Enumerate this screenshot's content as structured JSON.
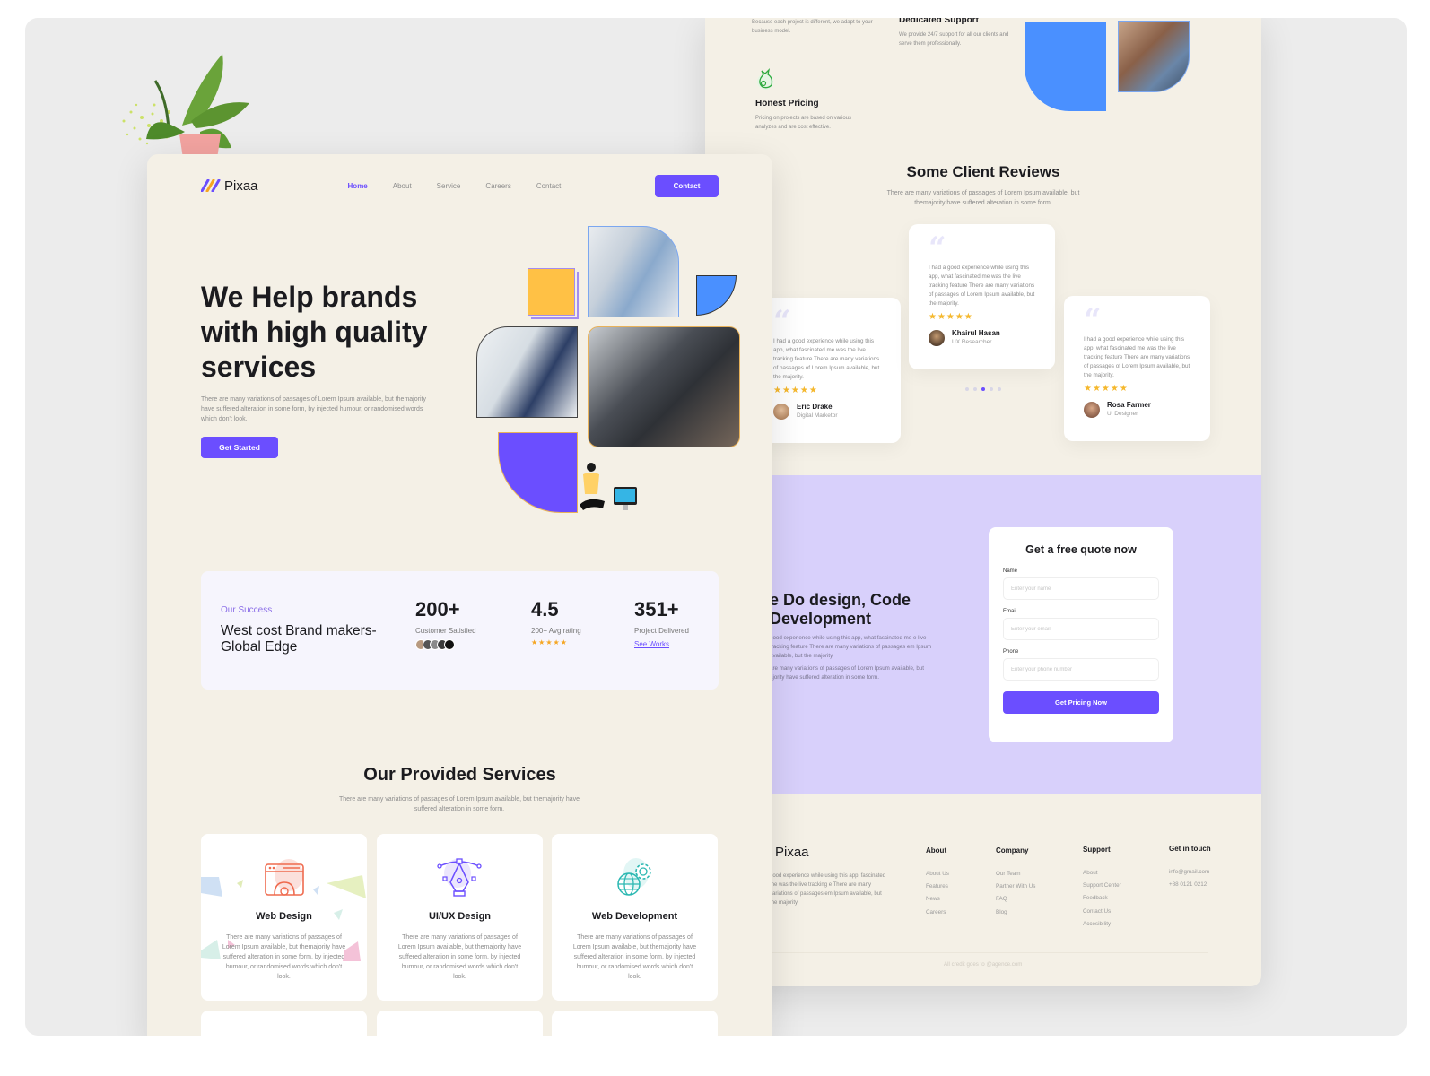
{
  "back_page": {
    "features": [
      {
        "title": "",
        "text": "Because each project is different, we adapt to your business model."
      },
      {
        "title": "Dedicated Support",
        "text": "We provide 24/7 support for all our clients and serve them professionally."
      },
      {
        "title": "Honest Pricing",
        "text": "Pricing on projects are based on various analyzes and are cost effective."
      }
    ],
    "reviews": {
      "title": "Some Client Reviews",
      "subtitle": "There are many variations of passages of Lorem Ipsum available, but themajority have suffered alteration in some form.",
      "items": [
        {
          "text": "I had a good experience while using this app, what fascinated me was the live tracking feature There are many variations of passages of Lorem Ipsum available, but the majority.",
          "stars": "★★★★★",
          "name": "Eric Drake",
          "role": "Digital Marketor"
        },
        {
          "text": "I had a good experience while using this app, what fascinated me was the live tracking feature There are many variations of passages of Lorem Ipsum available, but the majority.",
          "stars": "★★★★★",
          "name": "Khairul Hasan",
          "role": "UX Researcher"
        },
        {
          "text": "I had a good experience while using this app, what fascinated me was the live tracking feature There are many variations of passages of Lorem Ipsum available, but the majority.",
          "stars": "★★★★★",
          "name": "Rosa Farmer",
          "role": "UI Designer"
        }
      ],
      "active_dot": 2,
      "dot_count": 5
    },
    "quote_section": {
      "title": "e Do design, Code Development",
      "text1": "good experience while using this app, what fascinated me e live tracking feature There are many variations of passages em Ipsum available, but the majority.",
      "text2": "are many variations of passages of Lorem Ipsum available, but ajority have suffered alteration in some form.",
      "form": {
        "title": "Get a free quote now",
        "name_label": "Name",
        "name_placeholder": "Enter your name",
        "email_label": "Email",
        "email_placeholder": "Enter your email",
        "phone_label": "Phone",
        "phone_placeholder": "Enter your phone number",
        "submit": "Get Pricing Now"
      }
    },
    "footer": {
      "brand": "Pixaa",
      "text": "good experience while using this app, fascinated me was the live tracking e There are many variations of passages em Ipsum available, but the majority.",
      "columns": [
        {
          "title": "About",
          "links": [
            "About Us",
            "Features",
            "News",
            "Careers"
          ]
        },
        {
          "title": "Company",
          "links": [
            "Our Team",
            "Partner With Us",
            "FAQ",
            "Blog"
          ]
        },
        {
          "title": "Support",
          "links": [
            "About",
            "Support Center",
            "Feedback",
            "Contact Us",
            "Accesibility"
          ]
        },
        {
          "title": "Get in touch",
          "links": [
            "info@gmail.com",
            "+88 0121 0212"
          ]
        }
      ],
      "credit": "All credit goes to @agence.com"
    }
  },
  "front_page": {
    "brand": "Pixaa",
    "nav": [
      "Home",
      "About",
      "Service",
      "Careers",
      "Contact"
    ],
    "nav_active": "Home",
    "nav_button": "Contact",
    "hero": {
      "title": "We Help brands with high quality services",
      "text": "There are many variations of passages of Lorem Ipsum available, but themajority  have suffered alteration in some form, by injected humour, or randomised words which don't look.",
      "cta": "Get Started"
    },
    "success": {
      "label": "Our Success",
      "headline": "West cost Brand makers-Global Edge",
      "stats": [
        {
          "value": "200+",
          "desc": "Customer Satisfied"
        },
        {
          "value": "4.5",
          "desc": "200+ Avg rating",
          "stars": "★★★★★"
        },
        {
          "value": "351+",
          "desc": "Project Delivered",
          "link": "See Works"
        }
      ]
    },
    "services": {
      "title": "Our Provided Services",
      "subtitle": "There are many variations of passages of Lorem Ipsum available, but themajority have suffered alteration in some form.",
      "items": [
        {
          "title": "Web Design",
          "icon": "browser-gear-icon",
          "text": "There are many variations of passages of Lorem Ipsum available, but themajority have suffered alteration in some form, by injected humour, or randomised words which don't look."
        },
        {
          "title": "UI/UX Design",
          "icon": "pen-tool-icon",
          "text": "There are many variations of passages of Lorem Ipsum available, but themajority have suffered alteration in some form, by injected humour, or randomised words which don't look."
        },
        {
          "title": "Web Development",
          "icon": "globe-gear-icon",
          "text": "There are many variations of passages of Lorem Ipsum available, but themajority have suffered alteration in some form, by injected humour, or randomised words which don't look."
        }
      ]
    }
  },
  "colors": {
    "accent": "#6b4eff",
    "background": "#f4f0e6",
    "blue": "#4a90ff",
    "yellow": "#ffc145",
    "star": "#f5b82e",
    "quote_band": "#d8d0fb"
  }
}
